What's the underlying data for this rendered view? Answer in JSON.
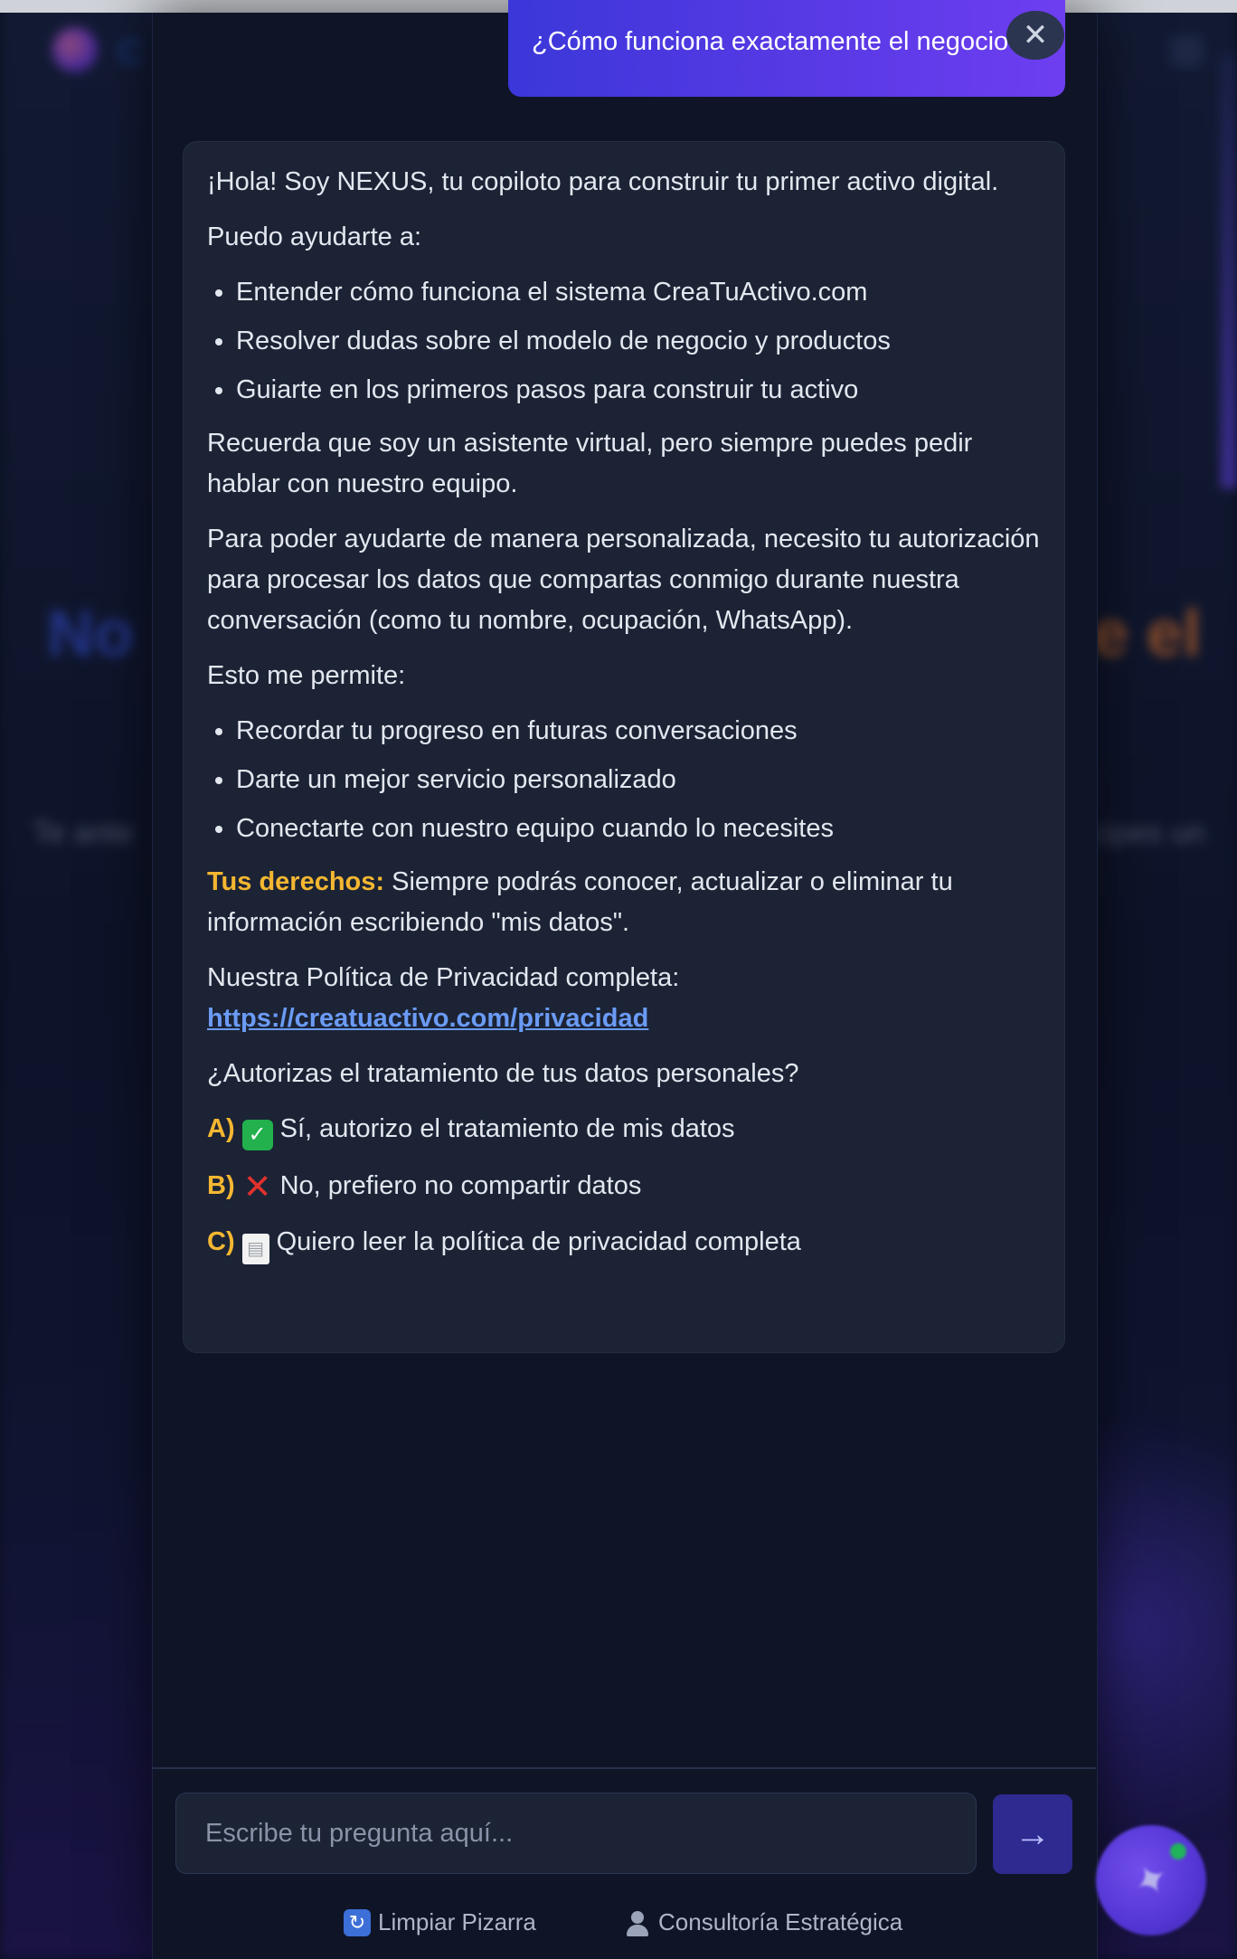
{
  "background": {
    "brand_fragment": "C",
    "hero_left": "No",
    "hero_right": "e el",
    "sub_left": "Te ante",
    "sub_right": "cipes un"
  },
  "chat": {
    "user_message": "¿Cómo funciona exactamente el negocio",
    "close_icon": "close-icon",
    "bot": {
      "greeting": "¡Hola! Soy NEXUS, tu copiloto para construir tu primer activo digital.",
      "help_intro": "Puedo ayudarte a:",
      "help_items": [
        "Entender cómo funciona el sistema CreaTuActivo.com",
        "Resolver dudas sobre el modelo de negocio y productos",
        "Guiarte en los primeros pasos para construir tu activo"
      ],
      "reminder": "Recuerda que soy un asistente virtual, pero siempre puedes pedir hablar con nuestro equipo.",
      "consent_request": "Para poder ayudarte de manera personalizada, necesito tu autorización para procesar los datos que compartas conmigo durante nuestra conversación (como tu nombre, ocupación, WhatsApp).",
      "allows_intro": "Esto me permite:",
      "allows_items": [
        "Recordar tu progreso en futuras conversaciones",
        "Darte un mejor servicio personalizado",
        "Conectarte con nuestro equipo cuando lo necesites"
      ],
      "rights_label": "Tus derechos:",
      "rights_text": " Siempre podrás conocer, actualizar o eliminar tu información escribiendo \"mis datos\".",
      "policy_label": "Nuestra Política de Privacidad completa:",
      "policy_url": "https://creatuactivo.com/privacidad",
      "question": "¿Autorizas el tratamiento de tus datos personales?",
      "options": [
        {
          "letter": "A)",
          "emoji": "✓",
          "icon": "check-mark-icon",
          "text": "Sí, autorizo el tratamiento de mis datos"
        },
        {
          "letter": "B)",
          "emoji": "✕",
          "icon": "cross-mark-icon",
          "text": "No, prefiero no compartir datos"
        },
        {
          "letter": "C)",
          "emoji": "▤",
          "icon": "document-icon",
          "text": "Quiero leer la política de privacidad completa"
        }
      ]
    },
    "input": {
      "placeholder": "Escribe tu pregunta aquí...",
      "send_icon": "arrow-right-icon"
    },
    "footer": {
      "clear_label": "Limpiar Pizarra",
      "clear_icon": "refresh-icon",
      "consult_label": "Consultoría Estratégica",
      "consult_icon": "person-icon"
    }
  },
  "colors": {
    "accent": "#f5b731",
    "link": "#6b9bf5",
    "user_bubble": "#4f39e2",
    "panel": "#0f1527",
    "bot_bubble": "#1b2335"
  }
}
